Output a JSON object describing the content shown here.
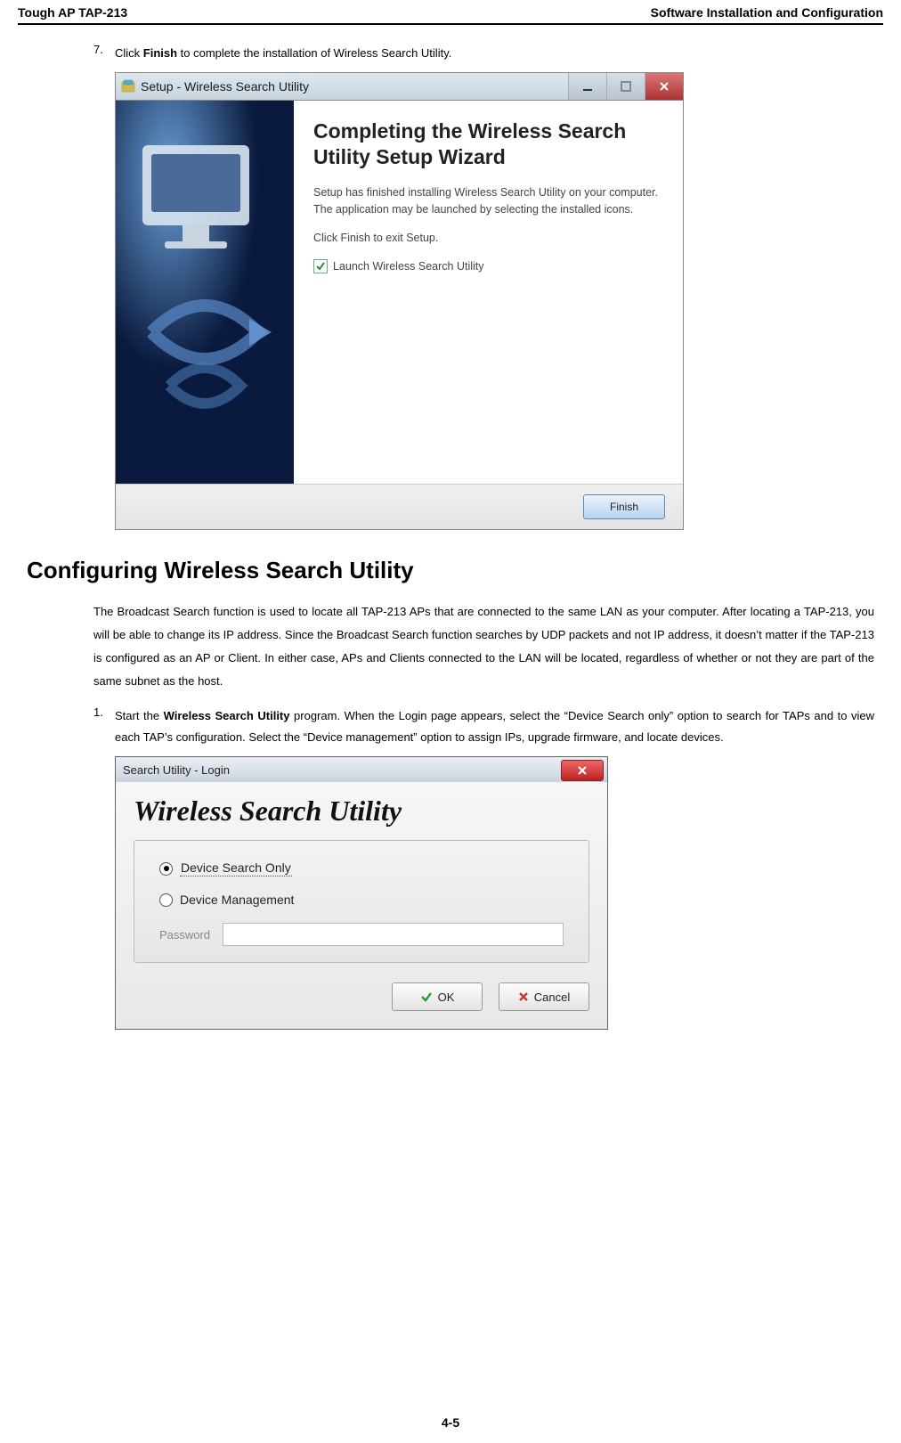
{
  "header": {
    "left": "Tough AP TAP-213",
    "right": "Software Installation and Configuration"
  },
  "step7": {
    "num": "7.",
    "text_before": "Click ",
    "text_bold": "Finish",
    "text_after": " to complete the installation of Wireless Search Utility."
  },
  "setup_window": {
    "title": "Setup - Wireless Search Utility",
    "heading": "Completing the Wireless Search Utility Setup Wizard",
    "desc": "Setup has finished installing Wireless Search Utility on your computer. The application may be launched by selecting the installed icons.",
    "click_finish": "Click Finish to exit Setup.",
    "checkbox_label": "Launch Wireless Search Utility",
    "finish_button": "Finish"
  },
  "section_heading": "Configuring Wireless Search Utility",
  "para1": "The Broadcast Search function is used to locate all TAP-213 APs that are connected to the same LAN as your computer. After locating a TAP-213, you will be able to change its IP address. Since the Broadcast Search function searches by UDP packets and not IP address, it doesn’t matter if the TAP-213 is configured as an AP or Client. In either case, APs and Clients connected to the LAN will be located, regardless of whether or not they are part of the same subnet as the host.",
  "step1": {
    "num": "1.",
    "text_before": "Start the ",
    "text_bold": "Wireless Search Utility",
    "text_after": " program. When the Login page appears, select the “Device Search only” option to search for TAPs and to view each TAP’s configuration. Select the “Device management” option to assign IPs, upgrade firmware, and locate devices."
  },
  "login_window": {
    "title": "Search Utility - Login",
    "heading": "Wireless Search Utility",
    "radio1": "Device Search Only",
    "radio2": "Device Management",
    "password_label": "Password",
    "ok_button": "OK",
    "cancel_button": "Cancel"
  },
  "page_number": "4-5"
}
